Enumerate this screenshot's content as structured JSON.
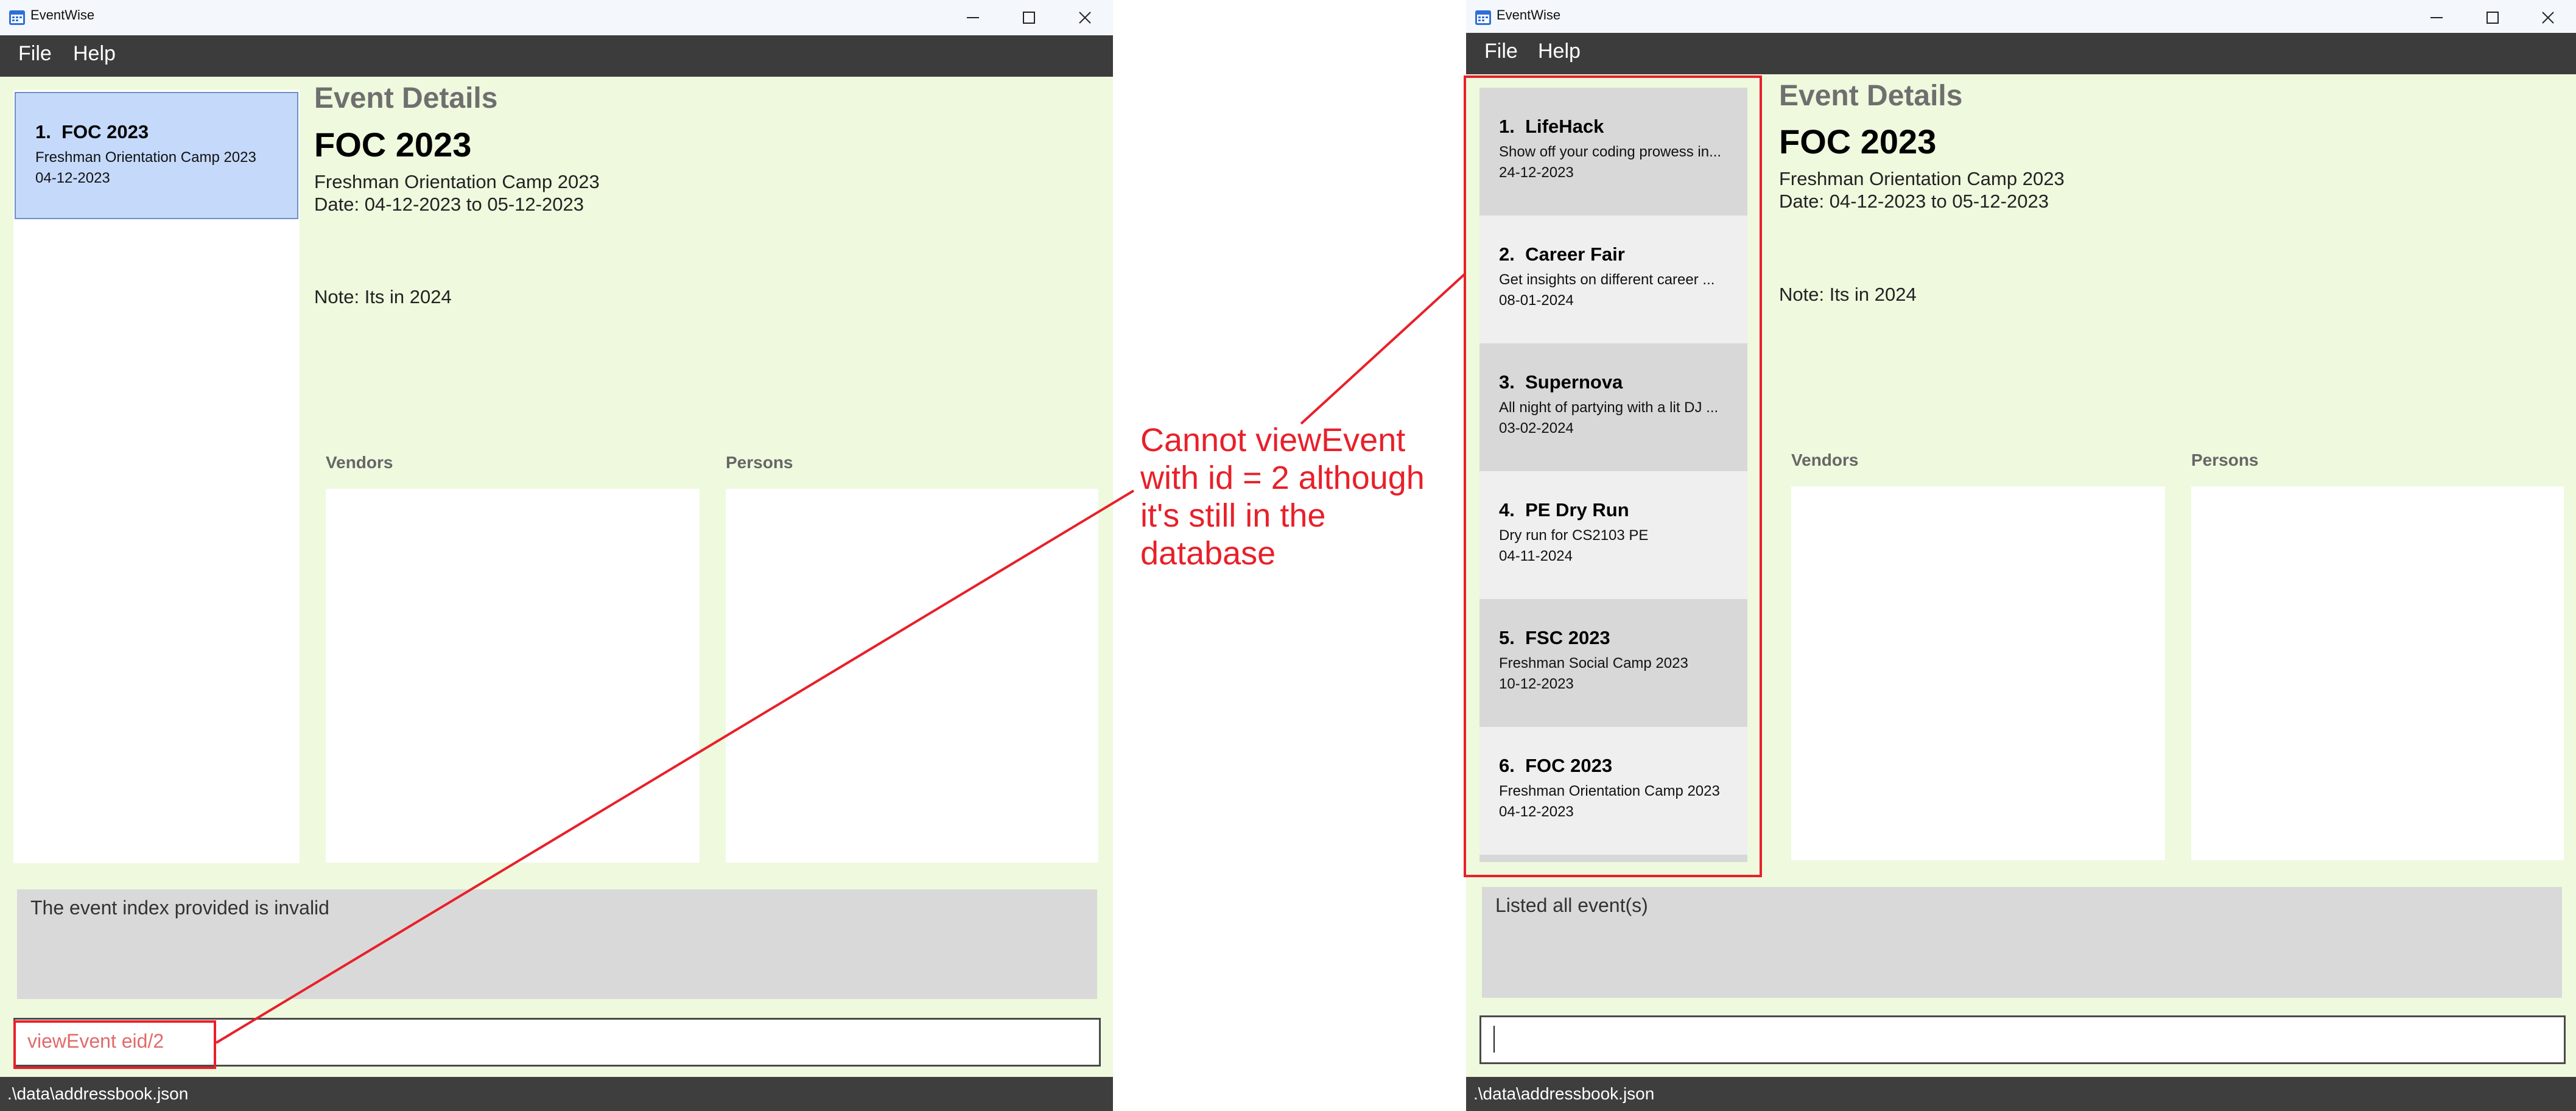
{
  "app": {
    "title": "EventWise"
  },
  "menu": {
    "file": "File",
    "help": "Help"
  },
  "details_label": "Event Details",
  "vendors_label": "Vendors",
  "persons_label": "Persons",
  "status_path": ".\\data\\addressbook.json",
  "left_window": {
    "events": [
      {
        "index": "1.",
        "name": "FOC 2023",
        "desc": "Freshman Orientation Camp 2023",
        "date": "04-12-2023"
      }
    ],
    "selected_event": {
      "name": "FOC 2023",
      "desc": "Freshman Orientation Camp 2023",
      "date": "Date: 04-12-2023 to 05-12-2023",
      "note": "Note: Its in 2024"
    },
    "result": "The event index provided is invalid",
    "command": "viewEvent eid/2"
  },
  "right_window": {
    "events": [
      {
        "index": "1.",
        "name": "LifeHack",
        "desc": "Show off your coding prowess in...",
        "date": "24-12-2023"
      },
      {
        "index": "2.",
        "name": "Career Fair",
        "desc": "Get insights on different career ...",
        "date": "08-01-2024"
      },
      {
        "index": "3.",
        "name": "Supernova",
        "desc": "All night of partying with a lit DJ ...",
        "date": "03-02-2024"
      },
      {
        "index": "4.",
        "name": "PE Dry Run",
        "desc": "Dry run for CS2103 PE",
        "date": "04-11-2024"
      },
      {
        "index": "5.",
        "name": "FSC 2023",
        "desc": "Freshman Social Camp 2023",
        "date": "10-12-2023"
      },
      {
        "index": "6.",
        "name": "FOC 2023",
        "desc": "Freshman Orientation Camp 2023",
        "date": "04-12-2023"
      }
    ],
    "selected_event": {
      "name": "FOC 2023",
      "desc": "Freshman Orientation Camp 2023",
      "date": "Date: 04-12-2023 to 05-12-2023",
      "note": "Note: Its in 2024"
    },
    "result": "Listed all event(s)",
    "command": ""
  },
  "annotation": {
    "lines": [
      "Cannot viewEvent",
      "with id = 2 although",
      "it's still in the",
      "database"
    ]
  },
  "colors": {
    "background": "#eef9de",
    "selected_card": "#c5d9fb",
    "card_dark": "#d8d8d8",
    "card_light": "#efefef",
    "annotation_red": "#e8202a",
    "bar_dark": "#3c3c3c"
  }
}
